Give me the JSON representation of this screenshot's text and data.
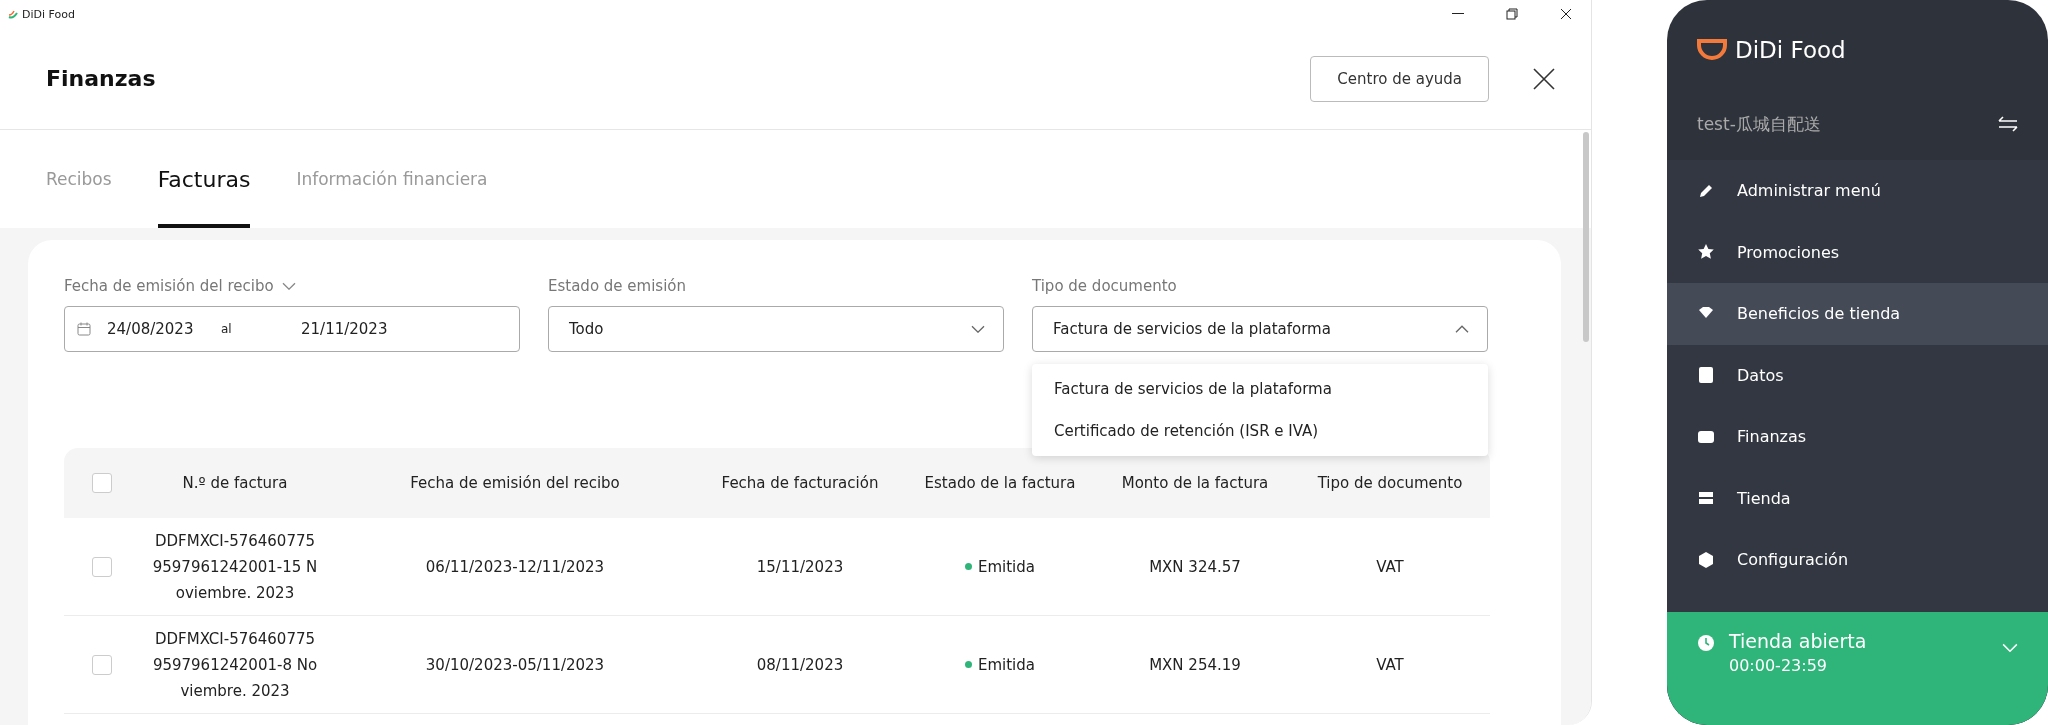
{
  "window": {
    "title": "DiDi Food"
  },
  "header": {
    "title": "Finanzas",
    "help_button": "Centro de ayuda"
  },
  "tabs": [
    {
      "label": "Recibos",
      "selected": false
    },
    {
      "label": "Facturas",
      "selected": true
    },
    {
      "label": "Información financiera",
      "selected": false
    }
  ],
  "filters": {
    "date_range": {
      "label": "Fecha de emisión del recibo",
      "start": "24/08/2023",
      "separator": "al",
      "end": "21/11/2023"
    },
    "status": {
      "label": "Estado de emisión",
      "value": "Todo",
      "expanded": false
    },
    "document_type": {
      "label": "Tipo de documento",
      "value": "Factura de servicios de la plataforma",
      "expanded": true,
      "options": [
        "Factura de servicios de la plataforma",
        "Certificado de retención (ISR e IVA)"
      ]
    }
  },
  "table": {
    "columns": [
      "N.º de factura",
      "Fecha de emisión del recibo",
      "Fecha de facturación",
      "Estado de la factura",
      "Monto de la factura",
      "Tipo de documento"
    ],
    "select_all_checked": false,
    "rows": [
      {
        "checked": false,
        "invoice": [
          "DDFMXCI-576460775",
          "9597961242001-15 N",
          "oviembre. 2023"
        ],
        "receipt_date": "06/11/2023-12/11/2023",
        "billing_date": "15/11/2023",
        "status": "Emitida",
        "color": "#2fb57a",
        "amount": "MXN 324.57",
        "doc_type": "VAT"
      },
      {
        "checked": false,
        "invoice": [
          "DDFMXCI-576460775",
          "9597961242001-8 No",
          "viembre. 2023"
        ],
        "receipt_date": "30/10/2023-05/11/2023",
        "billing_date": "08/11/2023",
        "status": "Emitida",
        "color": "#2fb57a",
        "amount": "MXN 254.19",
        "doc_type": "VAT"
      }
    ]
  },
  "sidebar": {
    "brand": "DiDi Food",
    "store": "test-瓜城自配送",
    "items": [
      {
        "label": "Administrar menú",
        "selected": false
      },
      {
        "label": "Promociones",
        "selected": false
      },
      {
        "label": "Beneficios de tienda",
        "selected": true
      },
      {
        "label": "Datos",
        "selected": false
      },
      {
        "label": "Finanzas",
        "selected": false
      },
      {
        "label": "Tienda",
        "selected": false
      },
      {
        "label": "Configuración",
        "selected": false
      }
    ],
    "store_status": {
      "label": "Tienda abierta",
      "hours": "00:00-23:59",
      "open": true
    }
  }
}
